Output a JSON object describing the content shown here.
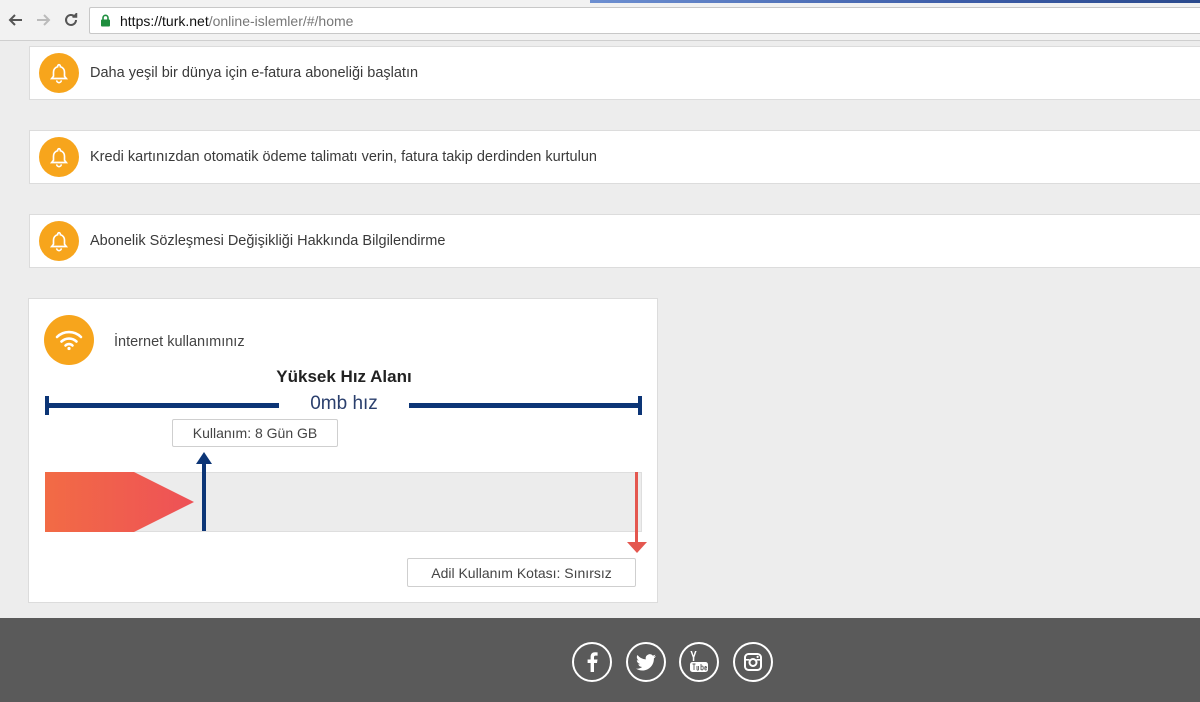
{
  "browser": {
    "url_host": "https://turk.net",
    "url_path": "/online-islemler/#/home"
  },
  "notifications": [
    {
      "text": "Daha yeşil bir dünya için e-fatura aboneliği başlatın",
      "icon": "bell-icon"
    },
    {
      "text": "Kredi kartınızdan otomatik ödeme talimatı verin, fatura takip derdinden kurtulun",
      "icon": "bell-icon"
    },
    {
      "text": "Abonelik Sözleşmesi Değişikliği Hakkında Bilgilendirme",
      "icon": "bell-icon"
    }
  ],
  "usage": {
    "icon": "wifi-icon",
    "title": "İnternet kullanımınız",
    "speed_title": "Yüksek Hız Alanı",
    "speed_value": "0mb hız",
    "used_label": "Kullanım: 8 Gün GB",
    "quota_label": "Adil Kullanım Kotası: Sınırsız",
    "used_fraction": 0.26
  },
  "footer": {
    "social": [
      "facebook-icon",
      "twitter-icon",
      "youtube-icon",
      "instagram-icon"
    ]
  },
  "colors": {
    "accent_orange": "#f7a51c",
    "navy": "#0c3576",
    "red": "#e4574f",
    "footer_bg": "#5a5a5a"
  }
}
